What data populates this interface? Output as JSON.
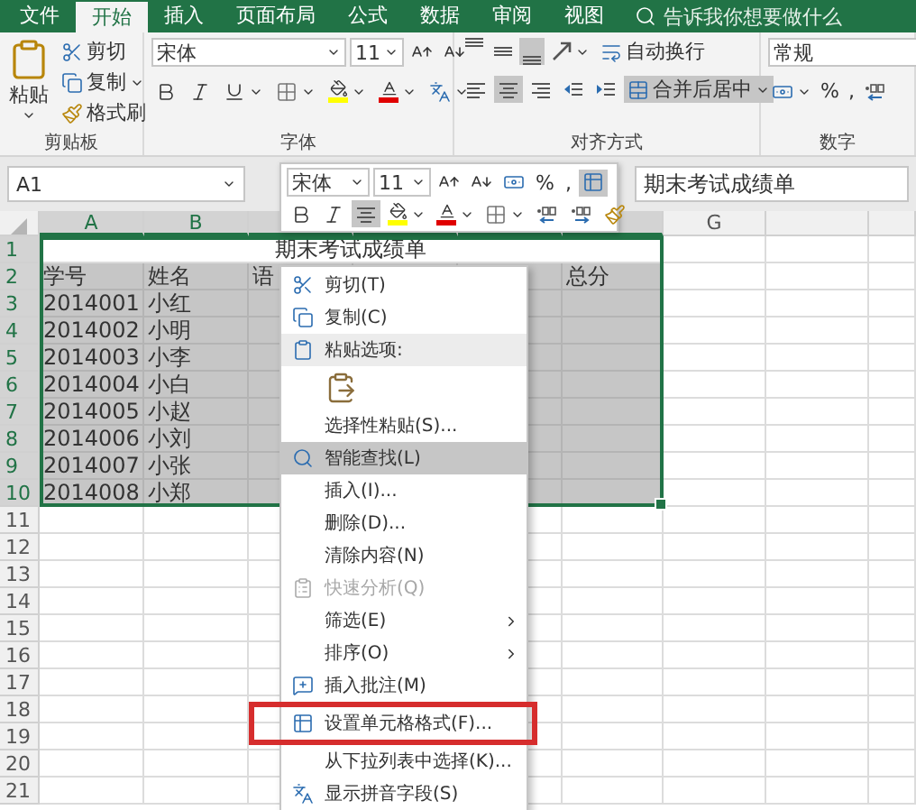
{
  "ribbon_tabs": [
    {
      "label": "文件",
      "selected": false
    },
    {
      "label": "开始",
      "selected": true
    },
    {
      "label": "插入",
      "selected": false
    },
    {
      "label": "页面布局",
      "selected": false
    },
    {
      "label": "公式",
      "selected": false
    },
    {
      "label": "数据",
      "selected": false
    },
    {
      "label": "审阅",
      "selected": false
    },
    {
      "label": "视图",
      "selected": false
    }
  ],
  "tell_me": "告诉我你想要做什么",
  "clipboard": {
    "paste": "粘贴",
    "cut": "剪切",
    "copy": "复制",
    "format_painter": "格式刷",
    "group": "剪贴板"
  },
  "font": {
    "name": "宋体",
    "size": "11",
    "group": "字体"
  },
  "alignment": {
    "vertical_align": [
      {
        "selected": false
      },
      {
        "selected": false
      },
      {
        "selected": true
      }
    ],
    "horizontal_align": [
      {
        "selected": false
      },
      {
        "selected": true
      },
      {
        "selected": false
      }
    ],
    "wrap_text": "自动换行",
    "merge_center": {
      "label": "合并后居中",
      "selected": true
    },
    "group": "对齐方式"
  },
  "number": {
    "format": "常规",
    "percent": "%",
    "comma": ",",
    "group": "数字"
  },
  "name_box": "A1",
  "formula": "期末考试成绩单",
  "columns": [
    {
      "label": "A",
      "selected": true
    },
    {
      "label": "B",
      "selected": true
    },
    {
      "selected": true
    },
    {
      "selected": true
    },
    {
      "selected": true
    },
    {
      "selected": true
    },
    {
      "label": "G",
      "selected": false
    },
    {
      "selected": false
    },
    {
      "selected": false
    }
  ],
  "rows": [
    {
      "number": "1",
      "selected": true,
      "cells": [
        {
          "text": "期末考试成绩单",
          "kind": "merged-title",
          "active": true
        }
      ]
    },
    {
      "number": "2",
      "selected": true,
      "cells": [
        {
          "text": "学号"
        },
        {
          "text": "姓名"
        },
        {
          "text": "语"
        },
        null,
        null,
        {
          "text": "总分"
        }
      ]
    },
    {
      "number": "3",
      "selected": true,
      "cells": [
        {
          "text": "2014001",
          "kind": "number"
        },
        {
          "text": "小红"
        }
      ]
    },
    {
      "number": "4",
      "selected": true,
      "cells": [
        {
          "text": "2014002",
          "kind": "number"
        },
        {
          "text": "小明"
        }
      ]
    },
    {
      "number": "5",
      "selected": true,
      "cells": [
        {
          "text": "2014003",
          "kind": "number"
        },
        {
          "text": "小李"
        }
      ]
    },
    {
      "number": "6",
      "selected": true,
      "cells": [
        {
          "text": "2014004",
          "kind": "number"
        },
        {
          "text": "小白"
        }
      ]
    },
    {
      "number": "7",
      "selected": true,
      "cells": [
        {
          "text": "2014005",
          "kind": "number"
        },
        {
          "text": "小赵"
        }
      ]
    },
    {
      "number": "8",
      "selected": true,
      "cells": [
        {
          "text": "2014006",
          "kind": "number"
        },
        {
          "text": "小刘"
        }
      ]
    },
    {
      "number": "9",
      "selected": true,
      "cells": [
        {
          "text": "2014007",
          "kind": "number"
        },
        {
          "text": "小张"
        }
      ]
    },
    {
      "number": "10",
      "selected": true,
      "cells": [
        {
          "text": "2014008",
          "kind": "number"
        },
        {
          "text": "小郑"
        }
      ]
    },
    {
      "number": "11",
      "selected": false
    },
    {
      "number": "12",
      "selected": false
    },
    {
      "number": "13",
      "selected": false
    },
    {
      "number": "14",
      "selected": false
    },
    {
      "number": "15",
      "selected": false
    },
    {
      "number": "16",
      "selected": false
    },
    {
      "number": "17",
      "selected": false
    },
    {
      "number": "18",
      "selected": false
    },
    {
      "number": "19",
      "selected": false
    },
    {
      "number": "20",
      "selected": false
    },
    {
      "number": "21",
      "selected": false
    }
  ],
  "mini_toolbar": {
    "font": "宋体",
    "size": "11",
    "percent": "%",
    "comma": ",",
    "table_format_selected": true,
    "align_selected": true
  },
  "context_menu": [
    {
      "kind": "command",
      "label": "剪切(T)",
      "selected": false,
      "disabled": false,
      "submenu": false,
      "framed": false
    },
    {
      "kind": "command",
      "label": "复制(C)",
      "selected": false,
      "disabled": false,
      "submenu": false,
      "framed": false
    },
    {
      "kind": "header",
      "label": "粘贴选项:",
      "selected": false,
      "disabled": false,
      "submenu": false,
      "framed": false
    },
    {
      "kind": "paste-options",
      "selected": false,
      "disabled": false,
      "submenu": false,
      "framed": false
    },
    {
      "kind": "command",
      "label": "选择性粘贴(S)...",
      "selected": false,
      "disabled": false,
      "submenu": false,
      "framed": false
    },
    {
      "kind": "command",
      "label": "智能查找(L)",
      "selected": true,
      "disabled": false,
      "submenu": false,
      "framed": false
    },
    {
      "kind": "command",
      "label": "插入(I)...",
      "selected": false,
      "disabled": false,
      "submenu": false,
      "framed": false
    },
    {
      "kind": "command",
      "label": "删除(D)...",
      "selected": false,
      "disabled": false,
      "submenu": false,
      "framed": false
    },
    {
      "kind": "command",
      "label": "清除内容(N)",
      "selected": false,
      "disabled": false,
      "submenu": false,
      "framed": false
    },
    {
      "kind": "command",
      "label": "快速分析(Q)",
      "selected": false,
      "disabled": true,
      "submenu": false,
      "framed": false
    },
    {
      "kind": "command",
      "label": "筛选(E)",
      "selected": false,
      "disabled": false,
      "submenu": true,
      "framed": false
    },
    {
      "kind": "command",
      "label": "排序(O)",
      "selected": false,
      "disabled": false,
      "submenu": true,
      "framed": false
    },
    {
      "kind": "command",
      "label": "插入批注(M)",
      "selected": false,
      "disabled": false,
      "submenu": false,
      "framed": false
    },
    {
      "kind": "command",
      "label": "设置单元格格式(F)...",
      "selected": false,
      "disabled": false,
      "submenu": false,
      "framed": true
    },
    {
      "kind": "command",
      "label": "从下拉列表中选择(K)...",
      "selected": false,
      "disabled": false,
      "submenu": false,
      "framed": false
    },
    {
      "kind": "command",
      "label": "显示拼音字段(S)",
      "selected": false,
      "disabled": false,
      "submenu": false,
      "framed": false
    }
  ]
}
